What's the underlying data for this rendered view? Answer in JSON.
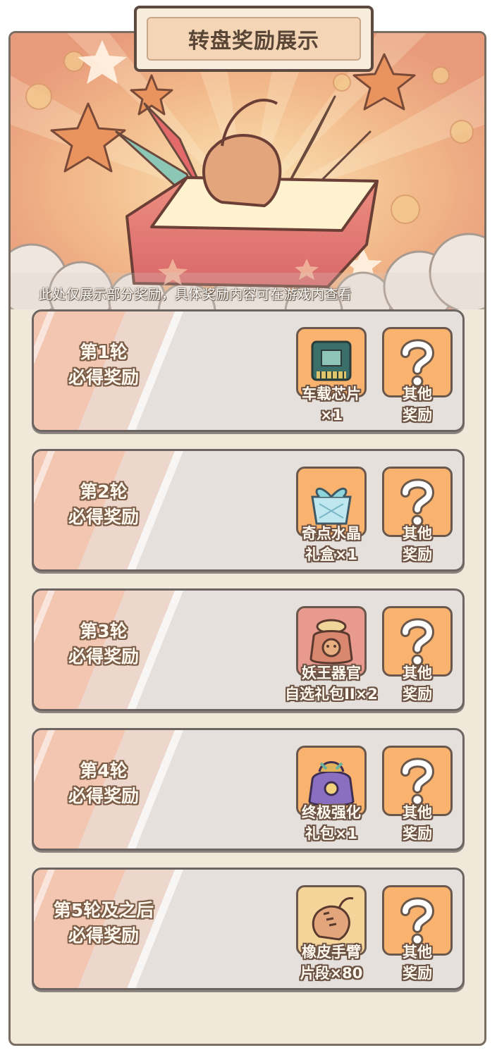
{
  "title": "转盘奖励展示",
  "banner_note": "此处仅展示部分奖励，具体奖励内容可在游戏内查看",
  "rounds": [
    {
      "label_line1": "第1轮",
      "label_line2": "必得奖励",
      "reward_line1": "车载芯片",
      "reward_line2": "×1",
      "reward_icon": "chip-icon",
      "other_line1": "其他",
      "other_line2": "奖励"
    },
    {
      "label_line1": "第2轮",
      "label_line2": "必得奖励",
      "reward_line1": "奇点水晶",
      "reward_line2": "礼盒×1",
      "reward_icon": "crystal-giftbox-icon",
      "other_line1": "其他",
      "other_line2": "奖励"
    },
    {
      "label_line1": "第3轮",
      "label_line2": "必得奖励",
      "reward_line1": "妖王器官",
      "reward_line2": "自选礼包II×2",
      "reward_icon": "demon-organ-pack-icon",
      "other_line1": "其他",
      "other_line2": "奖励"
    },
    {
      "label_line1": "第4轮",
      "label_line2": "必得奖励",
      "reward_line1": "终极强化",
      "reward_line2": "礼包×1",
      "reward_icon": "ultimate-upgrade-pack-icon",
      "other_line1": "其他",
      "other_line2": "奖励"
    },
    {
      "label_line1": "第5轮及之后",
      "label_line2": "必得奖励",
      "reward_line1": "橡皮手臂",
      "reward_line2": "片段×80",
      "reward_icon": "rubber-arm-fist-icon",
      "other_line1": "其他",
      "other_line2": "奖励"
    }
  ],
  "other_icon": "question-mark-icon",
  "colors": {
    "panel_bg": "#f0e8d8",
    "row_bg": "#e6e0dd",
    "item_orange": "#f9b36e",
    "accent_stripe": "#f3c3a9"
  }
}
